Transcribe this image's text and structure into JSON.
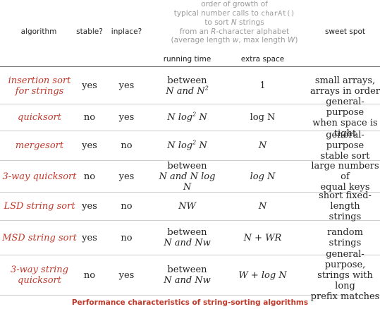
{
  "header": {
    "grey_line1": "order of growth of",
    "grey_line2_prefix": "typical number calls to ",
    "grey_line2_code": "charAt()",
    "grey_line3_prefix": "to sort ",
    "grey_line3_var": "N",
    "grey_line3_suffix": " strings",
    "grey_line4_prefix": "from an ",
    "grey_line4_var": "R",
    "grey_line4_suffix": "-character alphabet",
    "grey_line5_prefix": "(average length ",
    "grey_line5_var1": "w",
    "grey_line5_mid": ", max length ",
    "grey_line5_var2": "W",
    "grey_line5_suffix": ")",
    "col_algorithm": "algorithm",
    "col_stable": "stable?",
    "col_inplace": "inplace?",
    "col_running_time": "running time",
    "col_extra_space": "extra space",
    "col_sweet_spot": "sweet spot"
  },
  "rows": [
    {
      "algorithm": [
        "insertion sort",
        "for strings"
      ],
      "stable": "yes",
      "inplace": "yes",
      "running_time": [
        [
          "between"
        ],
        [
          "N and N",
          "2"
        ]
      ],
      "extra_space": "1",
      "sweet_spot": [
        "small arrays,",
        "arrays in order"
      ]
    },
    {
      "algorithm": [
        "quicksort"
      ],
      "stable": "no",
      "inplace": "yes",
      "running_time": "N log",
      "running_time_sup": "2",
      "running_time_tail": " N",
      "extra_space": "log N",
      "sweet_spot": [
        "general-purpose",
        "when space is tight"
      ]
    },
    {
      "algorithm": [
        "mergesort"
      ],
      "stable": "yes",
      "inplace": "no",
      "running_time": "N log",
      "running_time_sup": "2",
      "running_time_tail": " N",
      "extra_space": "N",
      "sweet_spot": [
        "general-purpose",
        "stable sort"
      ]
    },
    {
      "algorithm": [
        "3-way quicksort"
      ],
      "stable": "no",
      "inplace": "yes",
      "running_time": [
        "between",
        "N and N log N"
      ],
      "extra_space": "log N",
      "sweet_spot": [
        "large numbers of",
        "equal keys"
      ]
    },
    {
      "algorithm": [
        "LSD string sort"
      ],
      "stable": "yes",
      "inplace": "no",
      "running_time": "NW",
      "extra_space": "N",
      "sweet_spot": [
        "short fixed-length",
        "strings"
      ]
    },
    {
      "algorithm": [
        "MSD string sort"
      ],
      "stable": "yes",
      "inplace": "no",
      "running_time": [
        "between",
        "N and Nw"
      ],
      "extra_space": "N + WR",
      "sweet_spot": [
        "random strings"
      ]
    },
    {
      "algorithm": [
        "3-way string",
        "quicksort"
      ],
      "stable": "no",
      "inplace": "yes",
      "running_time": [
        "between",
        "N and Nw"
      ],
      "extra_space": "W + log N",
      "sweet_spot": [
        "general-purpose,",
        "strings with long",
        "prefix matches"
      ]
    }
  ],
  "caption": "Performance characteristics of string-sorting algorithms",
  "colors": {
    "accent": "#c0392b",
    "header_grey": "#9a9a9a",
    "rule": "#cfcfcf"
  }
}
